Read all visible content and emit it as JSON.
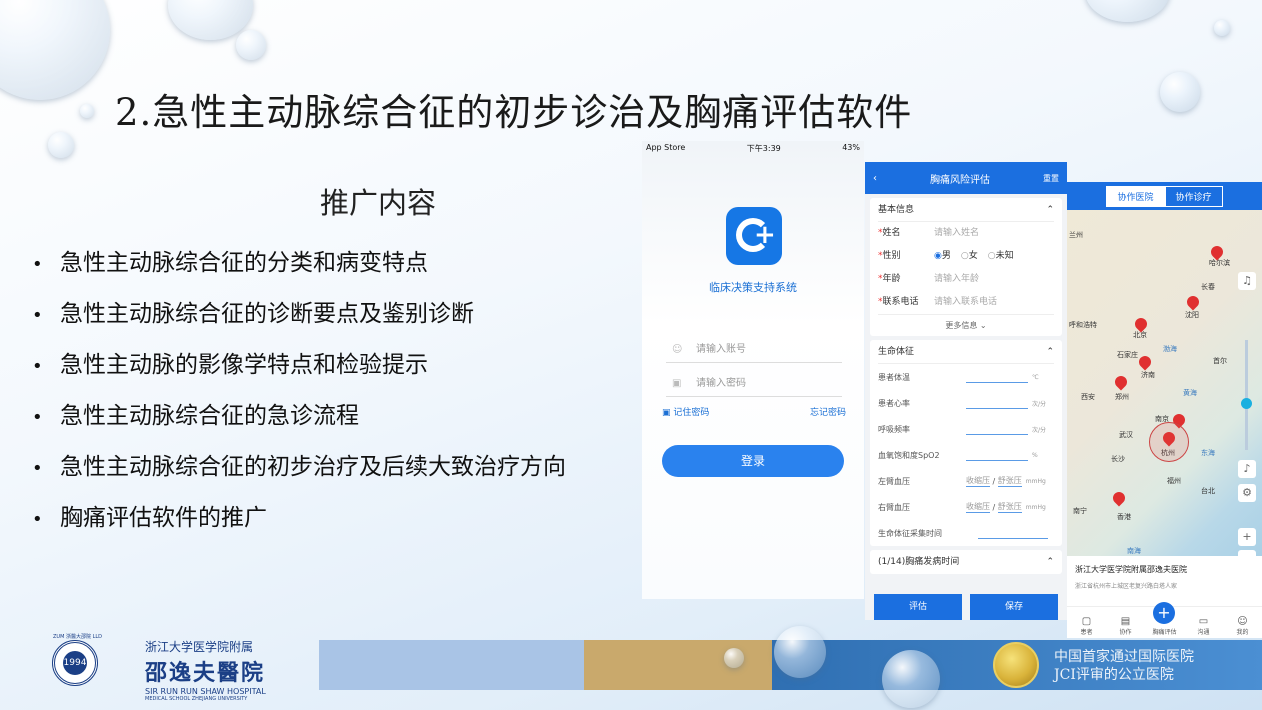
{
  "title": "2.急性主动脉综合征的初步诊治及胸痛评估软件",
  "subtitle": "推广内容",
  "bullets": [
    "急性主动脉综合征的分类和病变特点",
    "急性主动脉综合征的诊断要点及鉴别诊断",
    "急性主动脉的影像学特点和检验提示",
    "急性主动脉综合征的急诊流程",
    "急性主动脉综合征的初步治疗及后续大致治疗方向",
    "胸痛评估软件的推广"
  ],
  "phone1": {
    "status_left": "App Store",
    "status_time": "下午3:39",
    "status_right": "43%",
    "app_name": "临床决策支持系统",
    "account_placeholder": "请输入账号",
    "password_placeholder": "请输入密码",
    "remember": "记住密码",
    "forgot": "忘记密码",
    "login": "登录"
  },
  "phone2": {
    "header_title": "胸痛风险评估",
    "reset": "重置",
    "basic_info": "基本信息",
    "name_label": "姓名",
    "name_placeholder": "请输入姓名",
    "gender_label": "性别",
    "gender_options": [
      "男",
      "女",
      "未知"
    ],
    "age_label": "年龄",
    "age_placeholder": "请输入年龄",
    "phone_label": "联系电话",
    "phone_placeholder": "请输入联系电话",
    "more_info": "更多信息",
    "vitals_title": "生命体征",
    "vitals": [
      {
        "label": "患者体温",
        "unit": "℃"
      },
      {
        "label": "患者心率",
        "unit": "次/分"
      },
      {
        "label": "呼吸频率",
        "unit": "次/分"
      },
      {
        "label": "血氧饱和度SpO2",
        "unit": "%"
      }
    ],
    "left_bp": "左臂血压",
    "right_bp": "右臂血压",
    "systolic": "收缩压",
    "diastolic": "舒张压",
    "bp_unit": "mmHg",
    "collect_time": "生命体征采集时间",
    "onset": "(1/14)胸痛发病时间",
    "assess_btn": "评估",
    "save_btn": "保存"
  },
  "phone3": {
    "tab_hospital": "协作医院",
    "tab_clinic": "协作诊疗",
    "cities": [
      "兰州",
      "哈尔滨",
      "长春",
      "沈阳",
      "呼和浩特",
      "北京",
      "石家庄",
      "济南",
      "渤海",
      "首尔",
      "西安",
      "郑州",
      "黄海",
      "南京",
      "武汉",
      "杭州",
      "长沙",
      "东海",
      "福州",
      "台北",
      "香港",
      "南宁",
      "南海"
    ],
    "hospital_name": "浙江大学医学院附属邵逸夫医院",
    "hospital_address": "浙江省杭州市上城区老复兴路白塔人家",
    "nav": [
      "患者",
      "协作",
      "胸痛评估",
      "沟通",
      "我的"
    ]
  },
  "footer": {
    "logo_ring": "ZUM 浙醫大邵院 LLD",
    "logo_center": "1994",
    "line1": "浙江大学医学院附属",
    "line2": "邵逸夫醫院",
    "line3": "SIR RUN RUN SHAW HOSPITAL",
    "line4": "MEDICAL SCHOOL ZHEJIANG UNIVERSITY",
    "band_line1": "中国首家通过国际医院",
    "band_line2": "JCI评审的公立医院"
  }
}
